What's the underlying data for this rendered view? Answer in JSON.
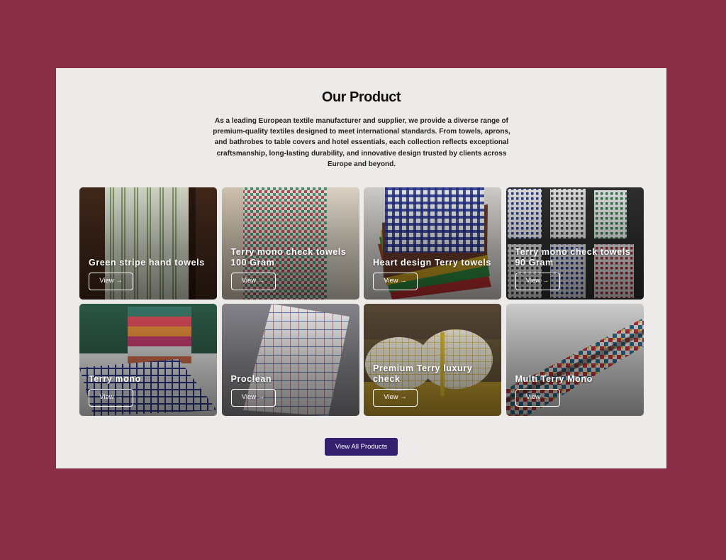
{
  "section": {
    "title": "Our Product",
    "description": "As a leading European textile manufacturer and supplier, we provide a diverse range of premium-quality textiles designed to meet international standards. From towels, aprons, and bathrobes to table covers and hotel essentials, each collection reflects exceptional craftsmanship, long-lasting durability, and innovative design trusted by clients across Europe and beyond."
  },
  "products": [
    {
      "name": "Green stripe hand towels",
      "button": "View →",
      "image": "green-striped-towel-image"
    },
    {
      "name": "Terry mono check towels 100 Gram",
      "button": "View →",
      "image": "check-towel-image"
    },
    {
      "name": "Heart design Terry towels",
      "button": "View →",
      "image": "fanned-check-towels-image"
    },
    {
      "name": "Terry mono check towels 90 Gram",
      "button": "View →",
      "image": "folded-check-towels-image"
    },
    {
      "name": "Terry mono",
      "button": "View →",
      "image": "stacked-towels-image"
    },
    {
      "name": "Proclean",
      "button": "View →",
      "image": "grid-check-towel-image"
    },
    {
      "name": "Premium Terry luxury check",
      "button": "View →",
      "image": "yellow-check-towels-image"
    },
    {
      "name": "Multi Terry Mono",
      "button": "View →",
      "image": "multicolor-towel-image"
    }
  ],
  "view_all_label": "View All Products",
  "colors": {
    "page_background": "#8a2e47",
    "panel_background": "#ecebea",
    "primary_button": "#33206e"
  }
}
